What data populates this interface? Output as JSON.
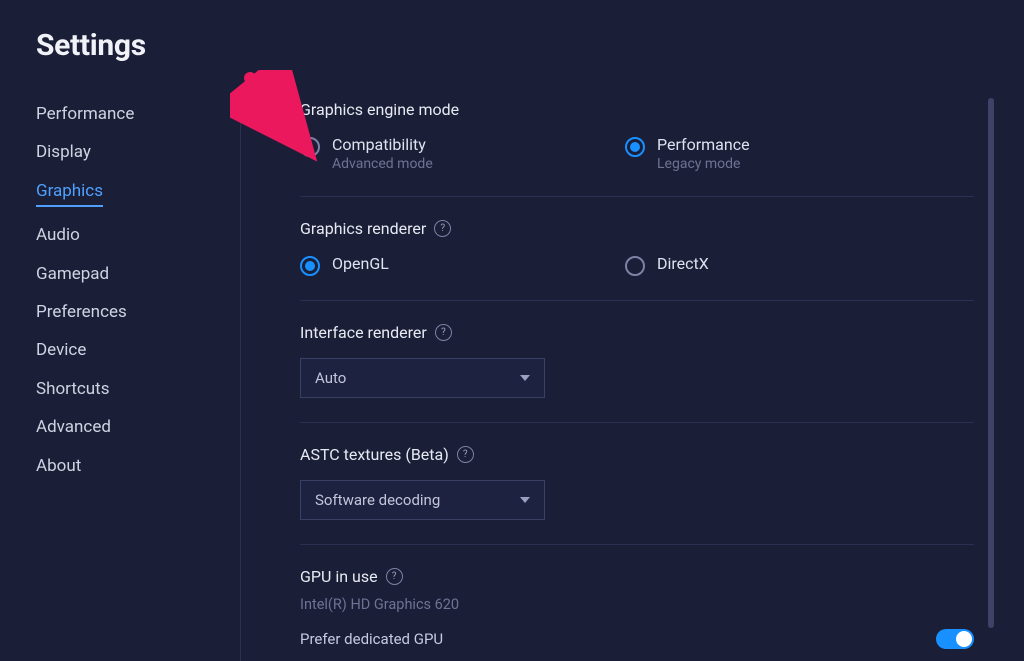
{
  "page": {
    "title": "Settings"
  },
  "sidebar": {
    "items": [
      {
        "label": "Performance"
      },
      {
        "label": "Display"
      },
      {
        "label": "Graphics",
        "active": true
      },
      {
        "label": "Audio"
      },
      {
        "label": "Gamepad"
      },
      {
        "label": "Preferences"
      },
      {
        "label": "Device"
      },
      {
        "label": "Shortcuts"
      },
      {
        "label": "Advanced"
      },
      {
        "label": "About"
      }
    ]
  },
  "sections": {
    "engine_mode": {
      "title": "Graphics engine mode",
      "options": [
        {
          "label": "Compatibility",
          "sub": "Advanced mode",
          "selected": false
        },
        {
          "label": "Performance",
          "sub": "Legacy mode",
          "selected": true
        }
      ]
    },
    "renderer": {
      "title": "Graphics renderer",
      "options": [
        {
          "label": "OpenGL",
          "selected": true
        },
        {
          "label": "DirectX",
          "selected": false
        }
      ]
    },
    "interface_renderer": {
      "title": "Interface renderer",
      "value": "Auto"
    },
    "astc": {
      "title": "ASTC textures (Beta)",
      "value": "Software decoding"
    },
    "gpu": {
      "title": "GPU in use",
      "detail": "Intel(R) HD Graphics 620",
      "toggle_label": "Prefer dedicated GPU",
      "toggle_on": true
    }
  },
  "icons": {
    "help_glyph": "?"
  }
}
